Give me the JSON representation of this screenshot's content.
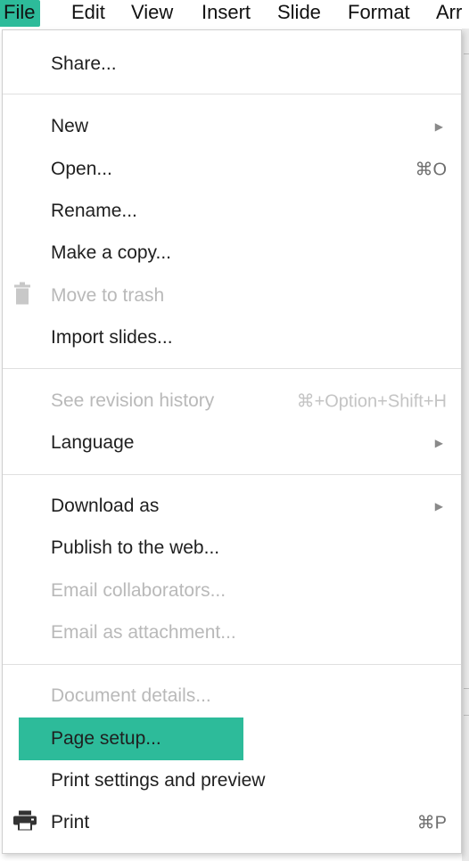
{
  "menubar": {
    "items": [
      "File",
      "Edit",
      "View",
      "Insert",
      "Slide",
      "Format",
      "Arr"
    ]
  },
  "file_menu": {
    "share": "Share...",
    "new": "New",
    "open": "Open...",
    "open_shortcut": "⌘O",
    "rename": "Rename...",
    "make_copy": "Make a copy...",
    "move_to_trash": "Move to trash",
    "import_slides": "Import slides...",
    "revision_history": "See revision history",
    "revision_history_shortcut": "⌘+Option+Shift+H",
    "language": "Language",
    "download_as": "Download as",
    "publish": "Publish to the web...",
    "email_collaborators": "Email collaborators...",
    "email_attachment": "Email as attachment...",
    "document_details": "Document details...",
    "page_setup": "Page setup...",
    "print_settings": "Print settings and preview",
    "print": "Print",
    "print_shortcut": "⌘P"
  },
  "colors": {
    "accent": "#2dbb9a",
    "disabled_text": "#b9b9b9"
  },
  "icons": {
    "trash": "trash-icon",
    "print": "printer-icon",
    "submenu": "submenu-arrow-icon"
  }
}
